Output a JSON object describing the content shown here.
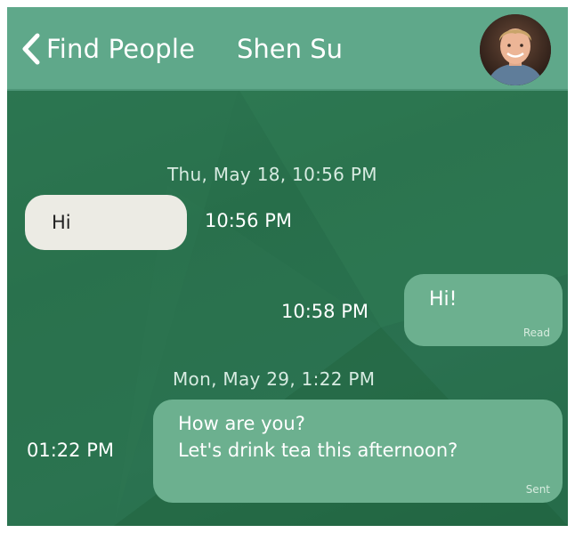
{
  "header": {
    "back_label": "Find People",
    "contact_name": "Shen Su"
  },
  "conversation": {
    "date_separators": [
      "Thu, May 18, 10:56 PM",
      "Mon, May 29, 1:22 PM"
    ],
    "messages": [
      {
        "direction": "incoming",
        "text": "Hi",
        "time": "10:56 PM",
        "status": ""
      },
      {
        "direction": "outgoing",
        "text": "Hi!",
        "time": "10:58 PM",
        "status": "Read"
      },
      {
        "direction": "outgoing",
        "text": "How are you?\nLet's drink tea this afternoon?",
        "time": "01:22 PM",
        "status": "Sent"
      }
    ]
  },
  "colors": {
    "background": "#2a7250",
    "header": "#5fa88a",
    "incoming_bubble": "#ecebe4",
    "outgoing_bubble": "#6cb08f"
  }
}
